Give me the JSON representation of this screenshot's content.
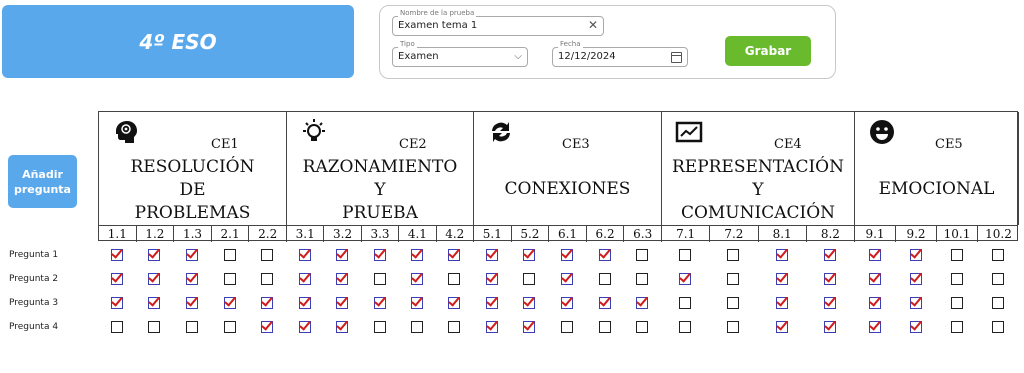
{
  "header": {
    "title": "4º ESO"
  },
  "form": {
    "name": {
      "label": "Nombre de la prueba",
      "value": "Examen tema 1",
      "clear_icon": "close-icon"
    },
    "type": {
      "label": "Tipo",
      "value": "Examen",
      "icon": "chevron-down-icon"
    },
    "date": {
      "label": "Fecha",
      "value": "12/12/2024",
      "icon": "calendar-icon"
    },
    "save_label": "Grabar"
  },
  "add_question_label": "Añadir pregunta",
  "competences": [
    {
      "code": "CE1",
      "icon": "brain-head-icon",
      "name_lines": [
        "RESOLUCIÓN",
        "DE",
        "PROBLEMAS"
      ],
      "subs": [
        "1.1",
        "1.2",
        "1.3",
        "2.1",
        "2.2"
      ]
    },
    {
      "code": "CE2",
      "icon": "lightbulb-icon",
      "name_lines": [
        "RAZONAMIENTO",
        "Y",
        "PRUEBA"
      ],
      "subs": [
        "3.1",
        "3.2",
        "3.3",
        "4.1",
        "4.2"
      ]
    },
    {
      "code": "CE3",
      "icon": "refresh-icon",
      "name_lines": [
        "CONEXIONES"
      ],
      "subs": [
        "5.1",
        "5.2",
        "6.1",
        "6.2",
        "6.3"
      ]
    },
    {
      "code": "CE4",
      "icon": "chart-screen-icon",
      "name_lines": [
        "REPRESENTACIÓN",
        "Y",
        "COMUNICACIÓN"
      ],
      "subs": [
        "7.1",
        "7.2",
        "8.1",
        "8.2"
      ]
    },
    {
      "code": "CE5",
      "icon": "smiley-icon",
      "name_lines": [
        "EMOCIONAL"
      ],
      "subs": [
        "9.1",
        "9.2",
        "10.1",
        "10.2"
      ]
    }
  ],
  "questions": [
    {
      "label": "Pregunta 1",
      "checks": [
        1,
        1,
        1,
        0,
        0,
        1,
        1,
        1,
        1,
        1,
        1,
        1,
        1,
        1,
        0,
        0,
        0,
        1,
        1,
        1,
        1,
        0,
        0
      ]
    },
    {
      "label": "Pregunta 2",
      "checks": [
        1,
        1,
        1,
        0,
        0,
        1,
        1,
        0,
        1,
        0,
        1,
        0,
        1,
        0,
        0,
        1,
        0,
        1,
        1,
        1,
        1,
        0,
        0
      ]
    },
    {
      "label": "Pregunta 3",
      "checks": [
        1,
        1,
        1,
        1,
        1,
        1,
        1,
        1,
        1,
        1,
        1,
        1,
        1,
        1,
        1,
        0,
        0,
        1,
        1,
        1,
        1,
        0,
        0
      ]
    },
    {
      "label": "Pregunta 4",
      "checks": [
        0,
        0,
        0,
        0,
        1,
        1,
        1,
        0,
        0,
        0,
        1,
        1,
        0,
        0,
        0,
        0,
        0,
        1,
        1,
        1,
        1,
        0,
        0
      ]
    }
  ]
}
